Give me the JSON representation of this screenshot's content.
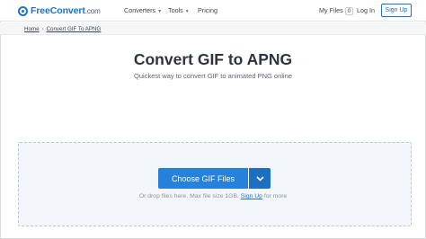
{
  "nav": {
    "logo_text": "FreeConvert",
    "logo_domain": ".com",
    "converters_label": "Converters",
    "tools_label": "Tools",
    "pricing_label": "Pricing",
    "my_files_label": "My Files",
    "my_files_count": "0",
    "login_label": "Log In",
    "signup_label": "Sign Up"
  },
  "breadcrumb": {
    "home": "Home",
    "separator": "›",
    "current": "Convert GIF To APNG"
  },
  "main": {
    "title": "Convert GIF to APNG",
    "subtitle": "Quickest way to convert GIF to animated PNG online"
  },
  "upload": {
    "button_label": "Choose GIF Files",
    "drop_text_before": "Or drop files here. Max file size 1GB.",
    "signup_link": "Sign Up",
    "drop_text_after": "for more"
  },
  "colors": {
    "accent": "#1a73c9",
    "button": "#2681db",
    "button_dark": "#1d6fc2",
    "dropzone_bg": "#f2f6fb"
  }
}
